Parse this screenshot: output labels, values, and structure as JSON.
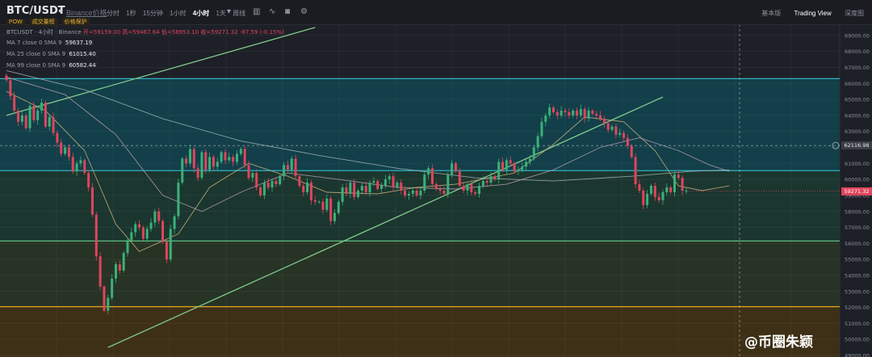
{
  "header": {
    "symbol": "BTC/USDT",
    "exchange": "Binance价格",
    "timeframes": [
      "分时",
      "1秒",
      "15分钟",
      "1小时",
      "4小时",
      "1天",
      "周线"
    ],
    "active_timeframe": "4小时",
    "right_links": [
      "基本版",
      "Trading View",
      "深度图"
    ],
    "active_link": "Trading View",
    "tags": [
      "POW",
      "成交量榜",
      "价格保护"
    ]
  },
  "legend": {
    "title": "BTCUSDT · 4小时 · Binance",
    "ohlc": "开=59159.00 高=59467.64 低=58953.10 收=59271.32 -87.59 (-0.15%)",
    "ma7_label": "MA 7 close 0 SMA 9",
    "ma7_value": "59637.19",
    "ma25_label": "MA 25 close 0 SMA 9",
    "ma25_value": "61015.40",
    "ma99_label": "MA 99 close 0 SMA 9",
    "ma99_value": "60582.44"
  },
  "price_labels": {
    "crosshair": "62116.98",
    "current": "59271.32"
  },
  "watermark": "@币圈朱颖",
  "colors": {
    "up": "#3bb07a",
    "down": "#e0455c",
    "zone_top": "#0f4a55",
    "zone_mid": "#1b3d33",
    "zone_low": "#2a3a25",
    "zone_bottom": "#4a3512",
    "line_cyan": "#2fb3c2",
    "line_green": "#5fbf83",
    "line_orange": "#e0a31f",
    "trend": "#7fc98a"
  },
  "chart_data": {
    "type": "candlestick",
    "symbol": "BTCUSDT",
    "interval": "4小时",
    "y_ticks": [
      69000,
      68000,
      67000,
      66000,
      65000,
      64000,
      63000,
      62000,
      61000,
      60000,
      59000,
      58000,
      57000,
      56000,
      55000,
      54000,
      53000,
      52000,
      51000,
      50000,
      49000
    ],
    "ylim": [
      48900,
      69700
    ],
    "horizontal_levels": [
      {
        "price": 66300,
        "color": "#2fb3c2"
      },
      {
        "price": 60550,
        "color": "#2fb3c2"
      },
      {
        "price": 56150,
        "color": "#5fbf83"
      },
      {
        "price": 52050,
        "color": "#e0a31f"
      }
    ],
    "zones": [
      {
        "from": 60550,
        "to": 66300,
        "color": "#0f4a55"
      },
      {
        "from": 56150,
        "to": 60550,
        "color": "#1b3d33"
      },
      {
        "from": 52050,
        "to": 56150,
        "color": "#2a3a25"
      },
      {
        "from": 48900,
        "to": 52050,
        "color": "#4a3512"
      }
    ],
    "trendlines": [
      {
        "from": [
          0,
          64000
        ],
        "to": [
          79,
          69500
        ]
      },
      {
        "from": [
          26,
          49500
        ],
        "to": [
          168,
          65150
        ]
      }
    ],
    "crosshair_price": 62116.98,
    "current_price": 59271.32,
    "closes": [
      66200,
      65200,
      64300,
      63600,
      64000,
      63200,
      64600,
      63700,
      64300,
      64800,
      63300,
      63900,
      62900,
      62300,
      61600,
      62000,
      61400,
      60500,
      61000,
      61200,
      60400,
      59500,
      57800,
      55200,
      53300,
      51800,
      52600,
      53800,
      54700,
      54300,
      55400,
      56200,
      56700,
      57200,
      57000,
      56300,
      56900,
      57300,
      58000,
      57400,
      56100,
      55000,
      56900,
      57700,
      59800,
      61300,
      61000,
      61900,
      60700,
      60100,
      61700,
      60600,
      61400,
      60800,
      61100,
      61700,
      61200,
      61400,
      61100,
      61600,
      61900,
      60900,
      60100,
      60400,
      59500,
      59000,
      59800,
      59500,
      59900,
      59700,
      60200,
      60900,
      60600,
      61300,
      60200,
      59600,
      59200,
      59800,
      58700,
      58600,
      58600,
      58100,
      58800,
      57400,
      57900,
      58600,
      59500,
      59100,
      59800,
      58900,
      59300,
      59600,
      59200,
      59800,
      59900,
      59400,
      59600,
      60000,
      60200,
      59500,
      59800,
      59300,
      59000,
      59100,
      59300,
      59000,
      59300,
      60300,
      60700,
      59700,
      59400,
      59300,
      59100,
      60300,
      61000,
      60500,
      59600,
      59300,
      59700,
      59200,
      59100,
      59600,
      59900,
      59800,
      60200,
      60000,
      61100,
      60600,
      61200,
      61000,
      60500,
      60600,
      60800,
      61100,
      61300,
      62000,
      62700,
      63600,
      64000,
      64500,
      64200,
      64000,
      64300,
      64200,
      64000,
      64300,
      64000,
      64400,
      63800,
      64300,
      64100,
      64000,
      63800,
      63500,
      63100,
      63300,
      62800,
      62900,
      62600,
      62100,
      61400,
      59700,
      59300,
      58400,
      59100,
      59600,
      58900,
      58700,
      59200,
      59500,
      59200,
      60300,
      60100,
      59300,
      59300
    ],
    "ma7": [
      [
        0,
        65500
      ],
      [
        10,
        64300
      ],
      [
        20,
        61800
      ],
      [
        28,
        57200
      ],
      [
        34,
        55500
      ],
      [
        44,
        56600
      ],
      [
        52,
        59500
      ],
      [
        62,
        61000
      ],
      [
        72,
        60200
      ],
      [
        82,
        59200
      ],
      [
        95,
        59100
      ],
      [
        105,
        59500
      ],
      [
        115,
        59700
      ],
      [
        130,
        60400
      ],
      [
        140,
        62200
      ],
      [
        148,
        63900
      ],
      [
        158,
        63600
      ],
      [
        166,
        61800
      ],
      [
        172,
        59600
      ],
      [
        178,
        59300
      ],
      [
        185,
        59600
      ]
    ],
    "ma25": [
      [
        0,
        66400
      ],
      [
        15,
        65300
      ],
      [
        28,
        62800
      ],
      [
        40,
        59000
      ],
      [
        50,
        58000
      ],
      [
        60,
        59200
      ],
      [
        72,
        60400
      ],
      [
        85,
        60000
      ],
      [
        100,
        59500
      ],
      [
        115,
        59400
      ],
      [
        128,
        59700
      ],
      [
        140,
        60600
      ],
      [
        152,
        62000
      ],
      [
        162,
        62600
      ],
      [
        172,
        61800
      ],
      [
        180,
        60900
      ],
      [
        185,
        60500
      ]
    ],
    "ma99": [
      [
        0,
        66800
      ],
      [
        20,
        65600
      ],
      [
        40,
        63800
      ],
      [
        60,
        62400
      ],
      [
        80,
        61500
      ],
      [
        100,
        60700
      ],
      [
        120,
        60100
      ],
      [
        140,
        59900
      ],
      [
        160,
        60200
      ],
      [
        175,
        60500
      ],
      [
        185,
        60600
      ]
    ]
  }
}
